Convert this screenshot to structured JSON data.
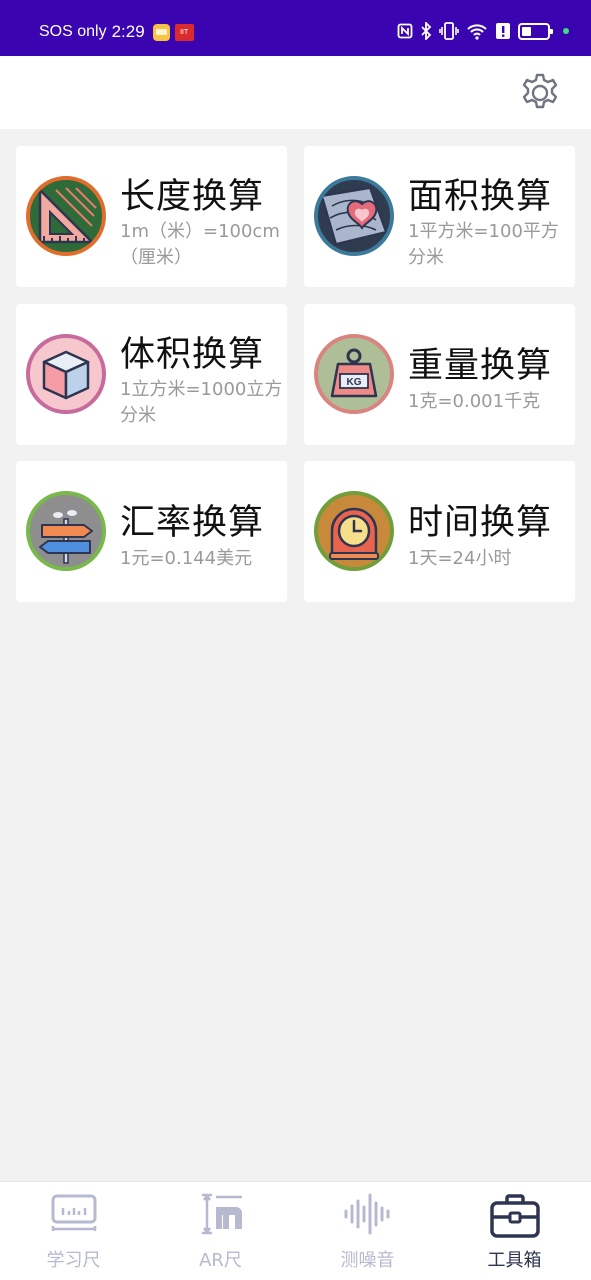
{
  "status_bar": {
    "carrier": "SOS only",
    "time": "2:29",
    "notif_badge": "IIT",
    "icons": [
      "nfc-icon",
      "bluetooth-icon",
      "vibrate-icon",
      "wifi-icon",
      "alert-icon",
      "battery-icon"
    ]
  },
  "header": {
    "settings_icon": "gear-icon"
  },
  "cards": [
    {
      "title": "长度换算",
      "desc": "1m（米）=100cm（厘米）",
      "icon": "ruler-triangle-icon"
    },
    {
      "title": "面积换算",
      "desc": "1平方米=100平方分米",
      "icon": "topographic-map-icon"
    },
    {
      "title": "体积换算",
      "desc": "1立方米=1000立方分米",
      "icon": "cube-icon"
    },
    {
      "title": "重量换算",
      "desc": "1克=0.001千克",
      "icon": "kg-weight-icon"
    },
    {
      "title": "汇率换算",
      "desc": "1元=0.144美元",
      "icon": "signpost-icon"
    },
    {
      "title": "时间换算",
      "desc": "1天=24小时",
      "icon": "clock-icon"
    }
  ],
  "nav": {
    "active_index": 3,
    "items": [
      {
        "label": "学习尺",
        "icon": "ruler-icon"
      },
      {
        "label": "AR尺",
        "icon": "ar-ruler-icon"
      },
      {
        "label": "测噪音",
        "icon": "sound-wave-icon"
      },
      {
        "label": "工具箱",
        "icon": "toolbox-icon"
      }
    ]
  },
  "colors": {
    "status_bar_bg": "#3a05b0",
    "nav_active": "#2d3550",
    "nav_inactive": "#b6b9cf"
  }
}
